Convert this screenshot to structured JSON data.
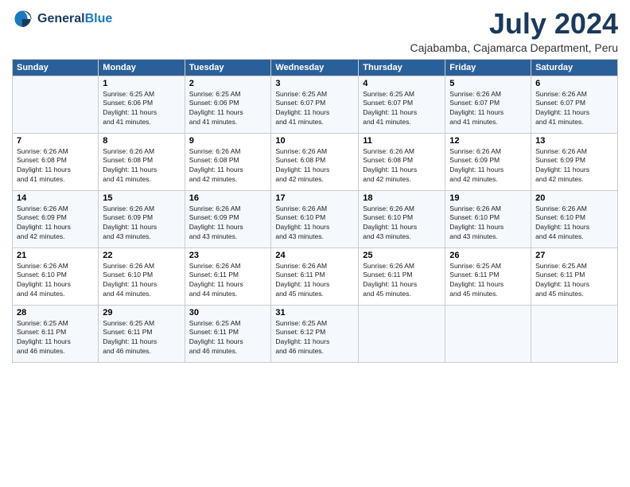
{
  "logo": {
    "line1": "General",
    "line2": "Blue"
  },
  "title": "July 2024",
  "subtitle": "Cajabamba, Cajamarca Department, Peru",
  "days_of_week": [
    "Sunday",
    "Monday",
    "Tuesday",
    "Wednesday",
    "Thursday",
    "Friday",
    "Saturday"
  ],
  "weeks": [
    [
      {
        "day": "",
        "info": ""
      },
      {
        "day": "1",
        "info": "Sunrise: 6:25 AM\nSunset: 6:06 PM\nDaylight: 11 hours\nand 41 minutes."
      },
      {
        "day": "2",
        "info": "Sunrise: 6:25 AM\nSunset: 6:06 PM\nDaylight: 11 hours\nand 41 minutes."
      },
      {
        "day": "3",
        "info": "Sunrise: 6:25 AM\nSunset: 6:07 PM\nDaylight: 11 hours\nand 41 minutes."
      },
      {
        "day": "4",
        "info": "Sunrise: 6:25 AM\nSunset: 6:07 PM\nDaylight: 11 hours\nand 41 minutes."
      },
      {
        "day": "5",
        "info": "Sunrise: 6:26 AM\nSunset: 6:07 PM\nDaylight: 11 hours\nand 41 minutes."
      },
      {
        "day": "6",
        "info": "Sunrise: 6:26 AM\nSunset: 6:07 PM\nDaylight: 11 hours\nand 41 minutes."
      }
    ],
    [
      {
        "day": "7",
        "info": "Sunrise: 6:26 AM\nSunset: 6:08 PM\nDaylight: 11 hours\nand 41 minutes."
      },
      {
        "day": "8",
        "info": "Sunrise: 6:26 AM\nSunset: 6:08 PM\nDaylight: 11 hours\nand 41 minutes."
      },
      {
        "day": "9",
        "info": "Sunrise: 6:26 AM\nSunset: 6:08 PM\nDaylight: 11 hours\nand 42 minutes."
      },
      {
        "day": "10",
        "info": "Sunrise: 6:26 AM\nSunset: 6:08 PM\nDaylight: 11 hours\nand 42 minutes."
      },
      {
        "day": "11",
        "info": "Sunrise: 6:26 AM\nSunset: 6:08 PM\nDaylight: 11 hours\nand 42 minutes."
      },
      {
        "day": "12",
        "info": "Sunrise: 6:26 AM\nSunset: 6:09 PM\nDaylight: 11 hours\nand 42 minutes."
      },
      {
        "day": "13",
        "info": "Sunrise: 6:26 AM\nSunset: 6:09 PM\nDaylight: 11 hours\nand 42 minutes."
      }
    ],
    [
      {
        "day": "14",
        "info": "Sunrise: 6:26 AM\nSunset: 6:09 PM\nDaylight: 11 hours\nand 42 minutes."
      },
      {
        "day": "15",
        "info": "Sunrise: 6:26 AM\nSunset: 6:09 PM\nDaylight: 11 hours\nand 43 minutes."
      },
      {
        "day": "16",
        "info": "Sunrise: 6:26 AM\nSunset: 6:09 PM\nDaylight: 11 hours\nand 43 minutes."
      },
      {
        "day": "17",
        "info": "Sunrise: 6:26 AM\nSunset: 6:10 PM\nDaylight: 11 hours\nand 43 minutes."
      },
      {
        "day": "18",
        "info": "Sunrise: 6:26 AM\nSunset: 6:10 PM\nDaylight: 11 hours\nand 43 minutes."
      },
      {
        "day": "19",
        "info": "Sunrise: 6:26 AM\nSunset: 6:10 PM\nDaylight: 11 hours\nand 43 minutes."
      },
      {
        "day": "20",
        "info": "Sunrise: 6:26 AM\nSunset: 6:10 PM\nDaylight: 11 hours\nand 44 minutes."
      }
    ],
    [
      {
        "day": "21",
        "info": "Sunrise: 6:26 AM\nSunset: 6:10 PM\nDaylight: 11 hours\nand 44 minutes."
      },
      {
        "day": "22",
        "info": "Sunrise: 6:26 AM\nSunset: 6:10 PM\nDaylight: 11 hours\nand 44 minutes."
      },
      {
        "day": "23",
        "info": "Sunrise: 6:26 AM\nSunset: 6:11 PM\nDaylight: 11 hours\nand 44 minutes."
      },
      {
        "day": "24",
        "info": "Sunrise: 6:26 AM\nSunset: 6:11 PM\nDaylight: 11 hours\nand 45 minutes."
      },
      {
        "day": "25",
        "info": "Sunrise: 6:26 AM\nSunset: 6:11 PM\nDaylight: 11 hours\nand 45 minutes."
      },
      {
        "day": "26",
        "info": "Sunrise: 6:25 AM\nSunset: 6:11 PM\nDaylight: 11 hours\nand 45 minutes."
      },
      {
        "day": "27",
        "info": "Sunrise: 6:25 AM\nSunset: 6:11 PM\nDaylight: 11 hours\nand 45 minutes."
      }
    ],
    [
      {
        "day": "28",
        "info": "Sunrise: 6:25 AM\nSunset: 6:11 PM\nDaylight: 11 hours\nand 46 minutes."
      },
      {
        "day": "29",
        "info": "Sunrise: 6:25 AM\nSunset: 6:11 PM\nDaylight: 11 hours\nand 46 minutes."
      },
      {
        "day": "30",
        "info": "Sunrise: 6:25 AM\nSunset: 6:11 PM\nDaylight: 11 hours\nand 46 minutes."
      },
      {
        "day": "31",
        "info": "Sunrise: 6:25 AM\nSunset: 6:12 PM\nDaylight: 11 hours\nand 46 minutes."
      },
      {
        "day": "",
        "info": ""
      },
      {
        "day": "",
        "info": ""
      },
      {
        "day": "",
        "info": ""
      }
    ]
  ]
}
